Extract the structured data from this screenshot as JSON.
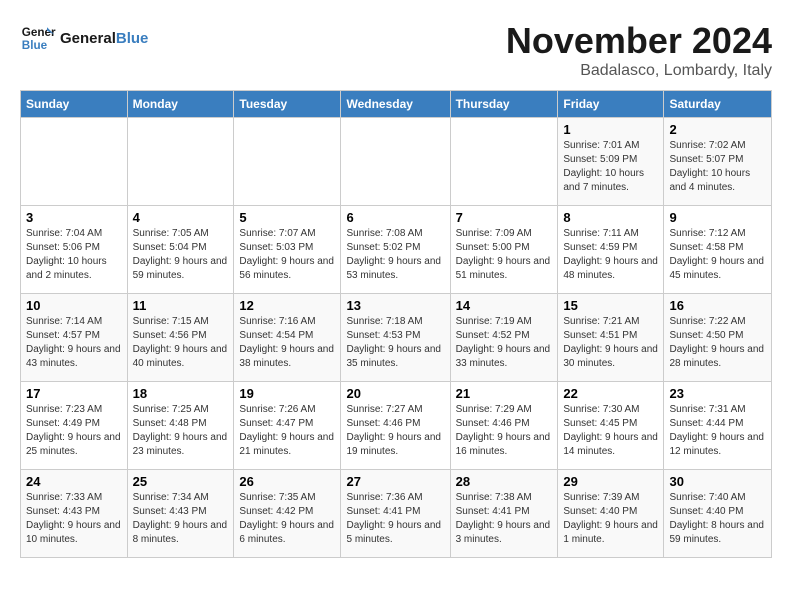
{
  "logo": {
    "line1": "General",
    "line2": "Blue"
  },
  "title": "November 2024",
  "location": "Badalasco, Lombardy, Italy",
  "weekdays": [
    "Sunday",
    "Monday",
    "Tuesday",
    "Wednesday",
    "Thursday",
    "Friday",
    "Saturday"
  ],
  "weeks": [
    [
      {
        "day": "",
        "info": ""
      },
      {
        "day": "",
        "info": ""
      },
      {
        "day": "",
        "info": ""
      },
      {
        "day": "",
        "info": ""
      },
      {
        "day": "",
        "info": ""
      },
      {
        "day": "1",
        "info": "Sunrise: 7:01 AM\nSunset: 5:09 PM\nDaylight: 10 hours and 7 minutes."
      },
      {
        "day": "2",
        "info": "Sunrise: 7:02 AM\nSunset: 5:07 PM\nDaylight: 10 hours and 4 minutes."
      }
    ],
    [
      {
        "day": "3",
        "info": "Sunrise: 7:04 AM\nSunset: 5:06 PM\nDaylight: 10 hours and 2 minutes."
      },
      {
        "day": "4",
        "info": "Sunrise: 7:05 AM\nSunset: 5:04 PM\nDaylight: 9 hours and 59 minutes."
      },
      {
        "day": "5",
        "info": "Sunrise: 7:07 AM\nSunset: 5:03 PM\nDaylight: 9 hours and 56 minutes."
      },
      {
        "day": "6",
        "info": "Sunrise: 7:08 AM\nSunset: 5:02 PM\nDaylight: 9 hours and 53 minutes."
      },
      {
        "day": "7",
        "info": "Sunrise: 7:09 AM\nSunset: 5:00 PM\nDaylight: 9 hours and 51 minutes."
      },
      {
        "day": "8",
        "info": "Sunrise: 7:11 AM\nSunset: 4:59 PM\nDaylight: 9 hours and 48 minutes."
      },
      {
        "day": "9",
        "info": "Sunrise: 7:12 AM\nSunset: 4:58 PM\nDaylight: 9 hours and 45 minutes."
      }
    ],
    [
      {
        "day": "10",
        "info": "Sunrise: 7:14 AM\nSunset: 4:57 PM\nDaylight: 9 hours and 43 minutes."
      },
      {
        "day": "11",
        "info": "Sunrise: 7:15 AM\nSunset: 4:56 PM\nDaylight: 9 hours and 40 minutes."
      },
      {
        "day": "12",
        "info": "Sunrise: 7:16 AM\nSunset: 4:54 PM\nDaylight: 9 hours and 38 minutes."
      },
      {
        "day": "13",
        "info": "Sunrise: 7:18 AM\nSunset: 4:53 PM\nDaylight: 9 hours and 35 minutes."
      },
      {
        "day": "14",
        "info": "Sunrise: 7:19 AM\nSunset: 4:52 PM\nDaylight: 9 hours and 33 minutes."
      },
      {
        "day": "15",
        "info": "Sunrise: 7:21 AM\nSunset: 4:51 PM\nDaylight: 9 hours and 30 minutes."
      },
      {
        "day": "16",
        "info": "Sunrise: 7:22 AM\nSunset: 4:50 PM\nDaylight: 9 hours and 28 minutes."
      }
    ],
    [
      {
        "day": "17",
        "info": "Sunrise: 7:23 AM\nSunset: 4:49 PM\nDaylight: 9 hours and 25 minutes."
      },
      {
        "day": "18",
        "info": "Sunrise: 7:25 AM\nSunset: 4:48 PM\nDaylight: 9 hours and 23 minutes."
      },
      {
        "day": "19",
        "info": "Sunrise: 7:26 AM\nSunset: 4:47 PM\nDaylight: 9 hours and 21 minutes."
      },
      {
        "day": "20",
        "info": "Sunrise: 7:27 AM\nSunset: 4:46 PM\nDaylight: 9 hours and 19 minutes."
      },
      {
        "day": "21",
        "info": "Sunrise: 7:29 AM\nSunset: 4:46 PM\nDaylight: 9 hours and 16 minutes."
      },
      {
        "day": "22",
        "info": "Sunrise: 7:30 AM\nSunset: 4:45 PM\nDaylight: 9 hours and 14 minutes."
      },
      {
        "day": "23",
        "info": "Sunrise: 7:31 AM\nSunset: 4:44 PM\nDaylight: 9 hours and 12 minutes."
      }
    ],
    [
      {
        "day": "24",
        "info": "Sunrise: 7:33 AM\nSunset: 4:43 PM\nDaylight: 9 hours and 10 minutes."
      },
      {
        "day": "25",
        "info": "Sunrise: 7:34 AM\nSunset: 4:43 PM\nDaylight: 9 hours and 8 minutes."
      },
      {
        "day": "26",
        "info": "Sunrise: 7:35 AM\nSunset: 4:42 PM\nDaylight: 9 hours and 6 minutes."
      },
      {
        "day": "27",
        "info": "Sunrise: 7:36 AM\nSunset: 4:41 PM\nDaylight: 9 hours and 5 minutes."
      },
      {
        "day": "28",
        "info": "Sunrise: 7:38 AM\nSunset: 4:41 PM\nDaylight: 9 hours and 3 minutes."
      },
      {
        "day": "29",
        "info": "Sunrise: 7:39 AM\nSunset: 4:40 PM\nDaylight: 9 hours and 1 minute."
      },
      {
        "day": "30",
        "info": "Sunrise: 7:40 AM\nSunset: 4:40 PM\nDaylight: 8 hours and 59 minutes."
      }
    ]
  ]
}
